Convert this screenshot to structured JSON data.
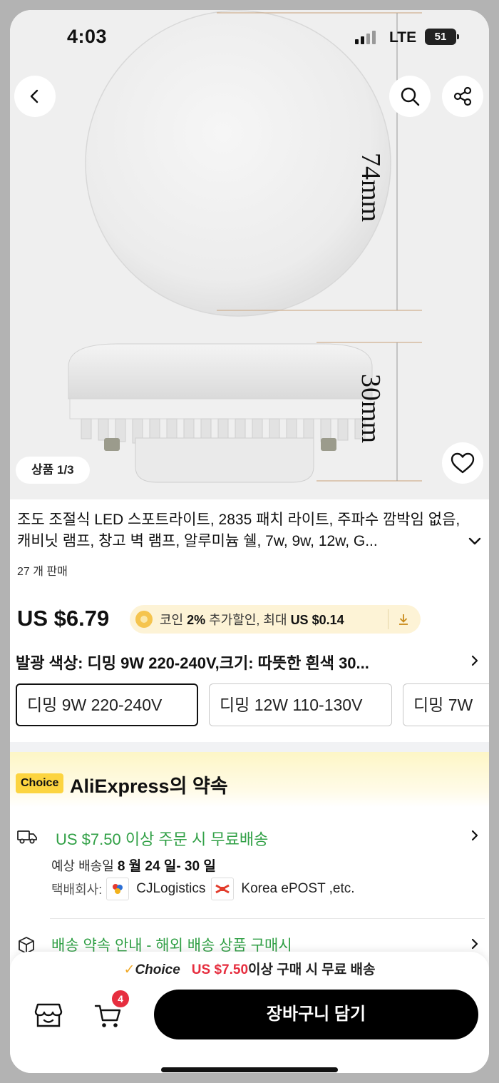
{
  "status": {
    "time": "4:03",
    "network": "LTE",
    "battery": "51"
  },
  "hero": {
    "dim_top": "74mm",
    "dim_side": "30mm",
    "page_indicator": "상품 1/3"
  },
  "product": {
    "title": "조도 조절식 LED 스포트라이트, 2835 패치 라이트, 주파수 깜박임 없음, 캐비닛 램프, 창고 벽 램프, 알루미늄 쉘, 7w, 9w, 12w, G...",
    "sold": "27 개 판매",
    "price": "US $6.79",
    "coin": {
      "prefix": "코인",
      "percent": "2%",
      "mid": "추가할인, 최대",
      "amount": "US $0.14"
    },
    "variant_label": "발광 색상: 디밍 9W 220-240V,크기: 따뜻한 흰색 30...",
    "options": [
      "디밍 9W 220-240V",
      "디밍 12W 110-130V",
      "디밍 7W"
    ]
  },
  "promise": {
    "choice_tag": "Choice",
    "title": "AliExpress의 약속",
    "shipping_line": "US $7.50 이상 주문 시 무료배송",
    "delivery_prefix": "예상 배송일",
    "delivery_date": "8 월 24 일- 30 일",
    "courier_label": "택배회사:",
    "courier1": "CJLogistics",
    "courier2": "Korea ePOST ,etc.",
    "policy_line": "배송 약속 안내 - 해외 배송 상품 구매시"
  },
  "bottom": {
    "choice_label": "Choice",
    "threshold": "US $7.50",
    "threshold_suffix": "이상 구매 시 무료 배송",
    "cart_count": "4",
    "cta": "장바구니 담기"
  },
  "colors": {
    "green": "#31a046",
    "red": "#e62e3f",
    "choice_yellow": "#fcd440"
  }
}
